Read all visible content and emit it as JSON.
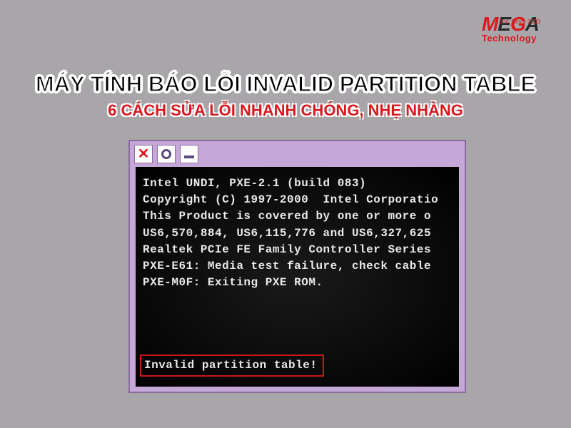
{
  "logo": {
    "brand_m": "M",
    "brand_ega": "E",
    "brand_g": "G",
    "brand_a": "A",
    "since": "Est. Since 2003",
    "tech": "Technology"
  },
  "title": {
    "main": "MÁY TÍNH BÁO LỖI INVALID PARTITION TABLE",
    "sub": "6 CÁCH SỬA LỖI NHANH CHÓNG, NHẸ NHÀNG"
  },
  "terminal": {
    "line1": "Intel UNDI, PXE-2.1 (build 083)",
    "line2": "Copyright (C) 1997-2000  Intel Corporatio",
    "line3": "",
    "line4": "This Product is covered by one or more o",
    "line5": "US6,570,884, US6,115,776 and US6,327,625",
    "line6": "",
    "line7": "Realtek PCIe FE Family Controller Series",
    "line8": "PXE-E61: Media test failure, check cable",
    "line9": "",
    "line10": "PXE-M0F: Exiting PXE ROM.",
    "error": "Invalid partition table!"
  }
}
